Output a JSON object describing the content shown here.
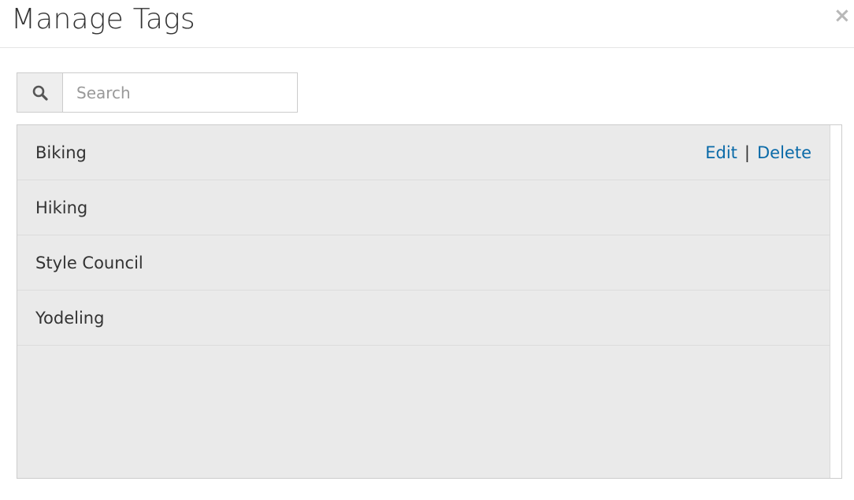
{
  "modal": {
    "title": "Manage Tags",
    "close_label": "×"
  },
  "search": {
    "placeholder": "Search",
    "value": ""
  },
  "tags": [
    {
      "name": "Biking",
      "edit_label": "Edit",
      "separator": "|",
      "delete_label": "Delete"
    },
    {
      "name": "Hiking"
    },
    {
      "name": "Style Council"
    },
    {
      "name": "Yodeling"
    }
  ],
  "colors": {
    "link": "#0a6aa8",
    "list_background": "#eaeaea",
    "border": "#cccccc"
  }
}
